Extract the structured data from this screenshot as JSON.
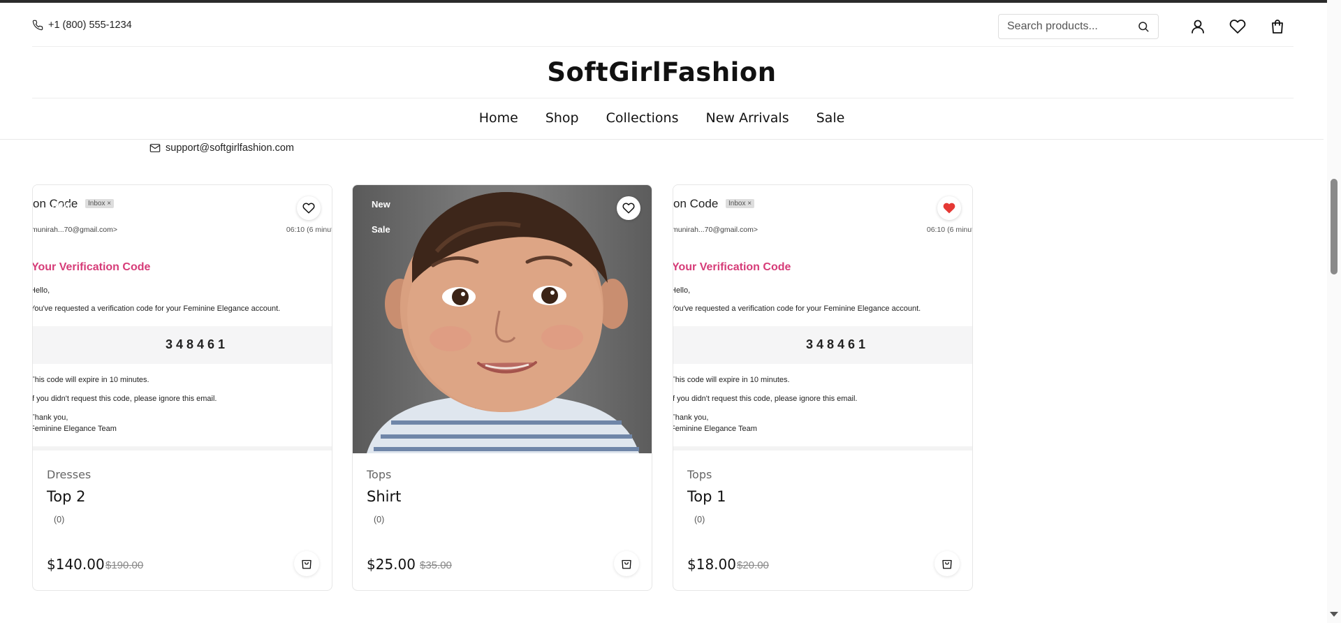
{
  "store": {
    "phone": "+1 (800) 555-1234",
    "email": "support@softgirlfashion.com",
    "logo": "SoftGirlFashion",
    "search_placeholder": "Search products..."
  },
  "nav": [
    "Home",
    "Shop",
    "Collections",
    "New Arrivals",
    "Sale"
  ],
  "icons": {
    "phone": "phone-icon",
    "mail": "mail-icon",
    "search": "search-icon",
    "account": "user-icon",
    "wishlist": "heart-icon",
    "cart": "shopping-bag-icon"
  },
  "email_image": {
    "subject": "on Code",
    "inbox": "Inbox ×",
    "from": "munirah...70@gmail.com>",
    "time": "06:10 (6 minut",
    "title": "Your Verification Code",
    "greeting": "Hello,",
    "line1": "You've requested a verification code for your Feminine Elegance account.",
    "code": "348461",
    "line2": "This code will expire in 10 minutes.",
    "line3": "If you didn't request this code, please ignore this email.",
    "signoff": "Thank you,",
    "team": "Feminine Elegance Team"
  },
  "badges": {
    "new": "New",
    "sale": "Sale"
  },
  "accent_colors": {
    "wishlist_active": "#e53935",
    "email_title": "#d63c78"
  },
  "products": [
    {
      "category": "Dresses",
      "name": "Top 2",
      "rating": "(0)",
      "price": "$140.00",
      "old_price": "$190.00",
      "image": "email-screenshot",
      "badges": [
        "New"
      ],
      "wishlisted": false
    },
    {
      "category": "Tops",
      "name": "Shirt",
      "rating": "(0)",
      "price": "$25.00",
      "old_price": "$35.00",
      "image": "child-portrait-photo",
      "badges": [
        "New",
        "Sale"
      ],
      "wishlisted": false
    },
    {
      "category": "Tops",
      "name": "Top 1",
      "rating": "(0)",
      "price": "$18.00",
      "old_price": "$20.00",
      "image": "email-screenshot",
      "badges": [],
      "wishlisted": true
    }
  ]
}
